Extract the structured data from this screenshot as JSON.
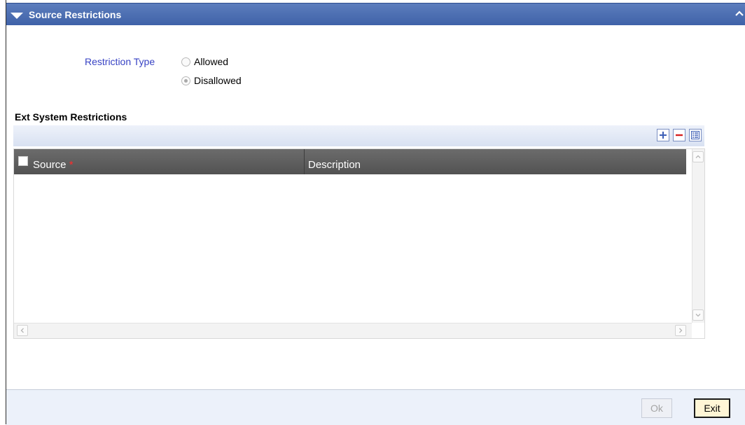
{
  "header": {
    "title": "Source Restrictions"
  },
  "restriction": {
    "label": "Restriction Type",
    "options": [
      "Allowed",
      "Disallowed"
    ],
    "selected": "Disallowed"
  },
  "ext_system": {
    "title": "Ext System Restrictions",
    "toolbar": {
      "add_icon": "plus-icon",
      "remove_icon": "minus-icon",
      "view_icon": "single-view-icon"
    },
    "columns": {
      "source": "Source",
      "required_marker": "*",
      "description": "Description"
    },
    "rows": []
  },
  "footer": {
    "ok_label": "Ok",
    "exit_label": "Exit"
  },
  "colors": {
    "titlebar": "#4a6cb0",
    "label": "#3843c4",
    "required": "#ff2a2a",
    "footer": "#ecf1fa"
  }
}
